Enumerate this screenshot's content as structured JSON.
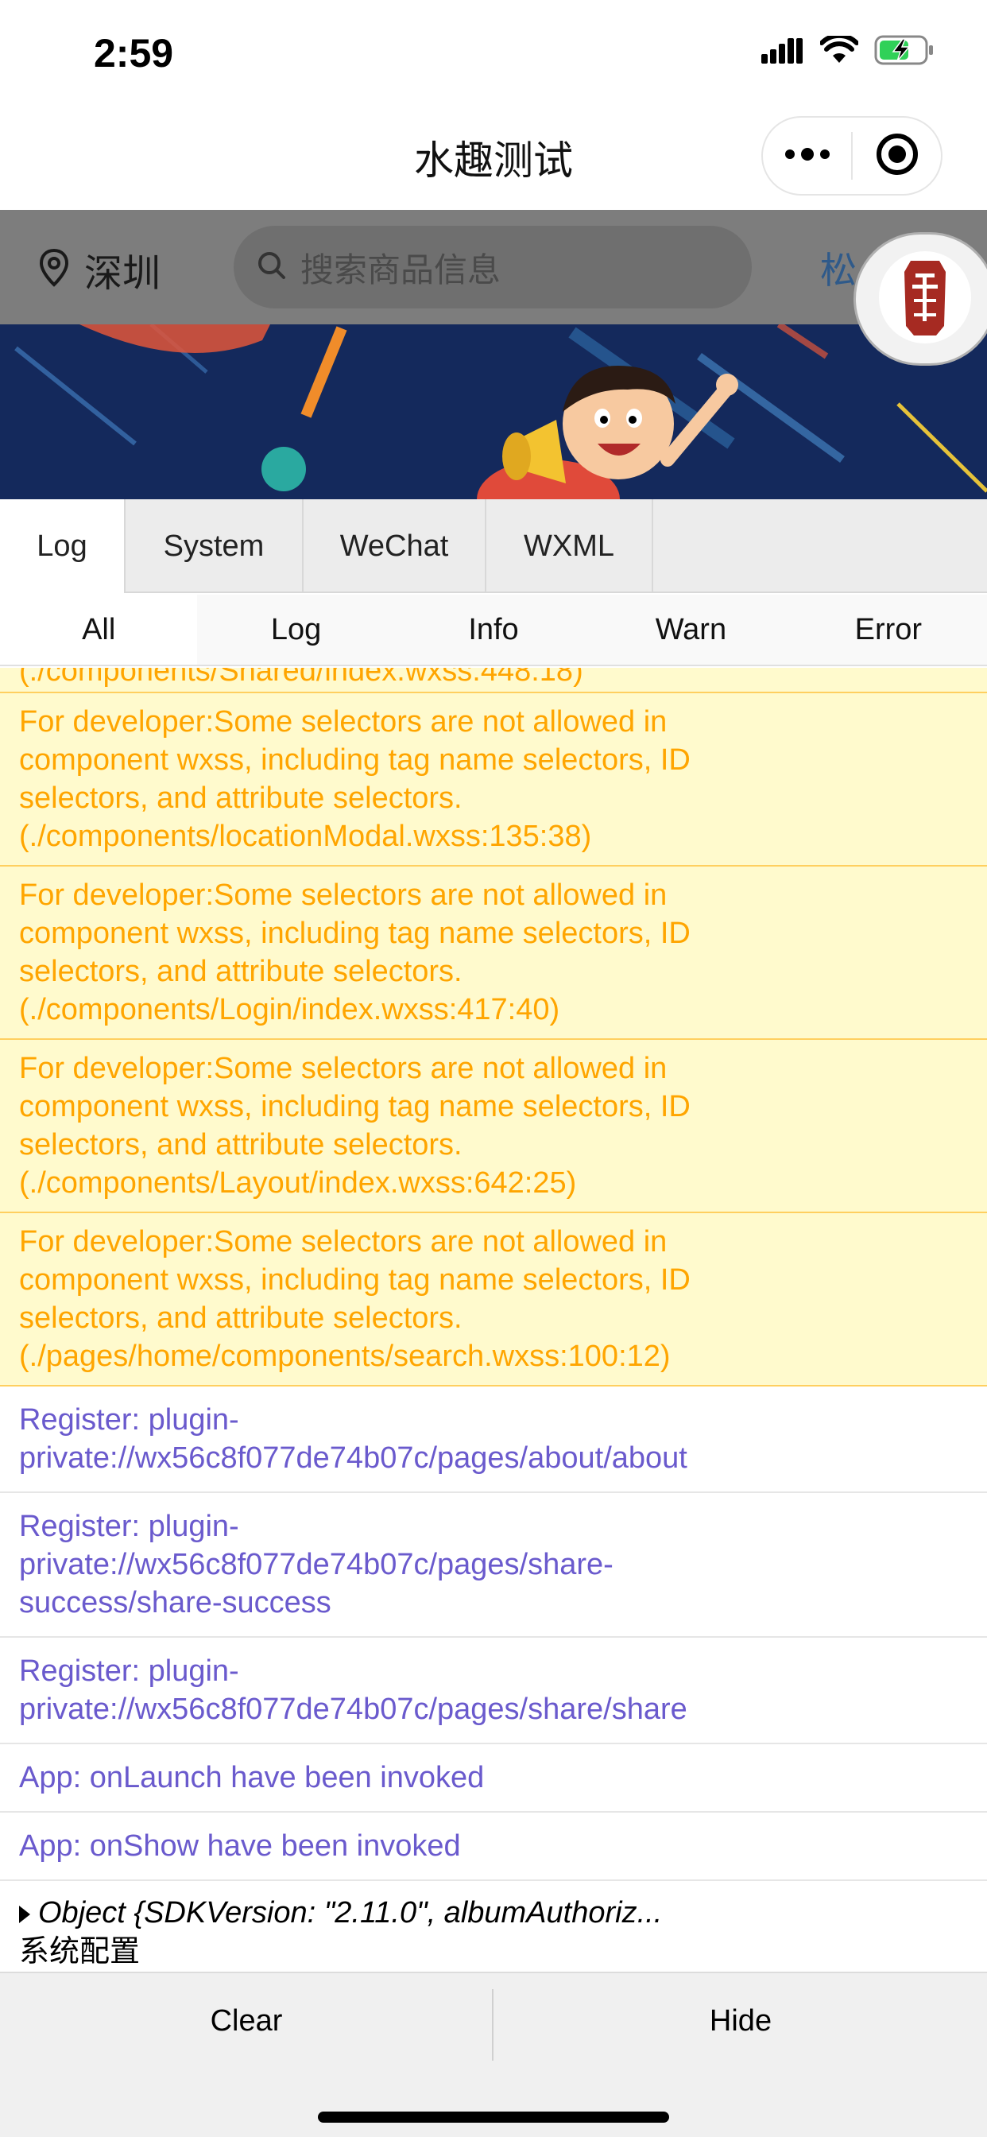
{
  "status_bar": {
    "time": "2:59",
    "icons": [
      "signal-icon",
      "wifi-icon",
      "battery-charging-icon"
    ],
    "battery_color": "#30d158"
  },
  "nav": {
    "title": "水趣测试",
    "capsule_icons": [
      "more-icon",
      "close-miniprogram-icon"
    ]
  },
  "page": {
    "location": "深圳",
    "search_placeholder": "搜索商品信息",
    "header_right_text": "松",
    "float_icon": "seal-logo-icon"
  },
  "console": {
    "tabs": [
      {
        "label": "Log",
        "active": true
      },
      {
        "label": "System",
        "active": false
      },
      {
        "label": "WeChat",
        "active": false
      },
      {
        "label": "WXML",
        "active": false
      }
    ],
    "filters": [
      {
        "label": "All",
        "active": true
      },
      {
        "label": "Log",
        "active": false
      },
      {
        "label": "Info",
        "active": false
      },
      {
        "label": "Warn",
        "active": false
      },
      {
        "label": "Error",
        "active": false
      }
    ],
    "logs": [
      {
        "type": "warn",
        "lines": [
          "For developer:Some selectors are not allowed in",
          "component wxss, including tag name selectors, ID",
          "selectors, and attribute selectors.",
          "(./components/locationModal.wxss:135:38)"
        ]
      },
      {
        "type": "warn",
        "lines": [
          "For developer:Some selectors are not allowed in",
          "component wxss, including tag name selectors, ID",
          "selectors, and attribute selectors.",
          "(./components/Login/index.wxss:417:40)"
        ]
      },
      {
        "type": "warn",
        "lines": [
          "For developer:Some selectors are not allowed in",
          "component wxss, including tag name selectors, ID",
          "selectors, and attribute selectors.",
          "(./components/Layout/index.wxss:642:25)"
        ]
      },
      {
        "type": "warn",
        "lines": [
          "For developer:Some selectors are not allowed in",
          "component wxss, including tag name selectors, ID",
          "selectors, and attribute selectors.",
          "(./pages/home/components/search.wxss:100:12)"
        ]
      },
      {
        "type": "log",
        "lines": [
          "Register: plugin-",
          "private://wx56c8f077de74b07c/pages/about/about"
        ]
      },
      {
        "type": "log",
        "lines": [
          "Register: plugin-",
          "private://wx56c8f077de74b07c/pages/share-",
          "success/share-success"
        ]
      },
      {
        "type": "log",
        "lines": [
          "Register: plugin-",
          "private://wx56c8f077de74b07c/pages/share/share"
        ]
      },
      {
        "type": "log",
        "lines": [
          "App: onLaunch have been invoked"
        ]
      },
      {
        "type": "log",
        "lines": [
          "App: onShow have been invoked"
        ]
      }
    ],
    "object_entry": {
      "summary": "Object {SDKVersion: \"2.11.0\", albumAuthoriz...",
      "label": "系统配置"
    },
    "footer": {
      "clear": "Clear",
      "hide": "Hide"
    }
  }
}
